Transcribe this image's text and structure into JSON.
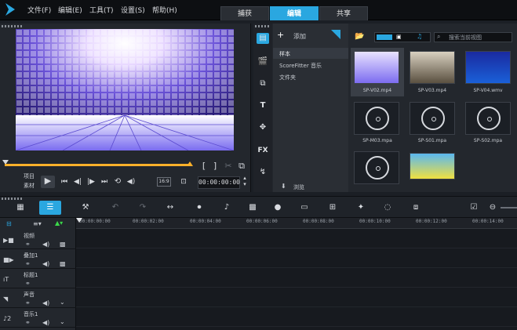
{
  "menubar": {
    "items": [
      "文件(F)",
      "编辑(E)",
      "工具(T)",
      "设置(S)",
      "帮助(H)"
    ],
    "tabs": [
      "捕获",
      "编辑",
      "共享"
    ],
    "active_tab": "编辑"
  },
  "preview": {
    "timecode": "00:00:00:00",
    "mode_project": "项目",
    "mode_clip": "素材",
    "aspect": "16:9"
  },
  "library": {
    "add_label": "添加",
    "search_placeholder": "搜索当前视图",
    "folders": [
      "样本",
      "ScoreFitter 音乐",
      "文件夹"
    ],
    "browse_label": "浏览",
    "items": [
      {
        "label": "SP-V02.mp4",
        "type": "video"
      },
      {
        "label": "SP-V03.mp4",
        "type": "video"
      },
      {
        "label": "SP-V04.wmv",
        "type": "video"
      },
      {
        "label": "SP-M03.mpa",
        "type": "audio"
      },
      {
        "label": "SP-S01.mpa",
        "type": "audio"
      },
      {
        "label": "SP-S02.mpa",
        "type": "audio"
      },
      {
        "label": "",
        "type": "audio"
      },
      {
        "label": "",
        "type": "image"
      }
    ]
  },
  "timeline": {
    "ruler": [
      "00:00:00:00",
      "00:00:02:00",
      "00:00:04:00",
      "00:00:06:00",
      "00:00:08:00",
      "00:00:10:00",
      "00:00:12:00",
      "00:00:14:00"
    ],
    "tracks": [
      "视频",
      "叠加1",
      "标题1",
      "声音",
      "音乐1"
    ]
  },
  "colors": {
    "accent": "#2aa7e0",
    "scrub": "#ffb12a",
    "background": "#1b1f25"
  }
}
